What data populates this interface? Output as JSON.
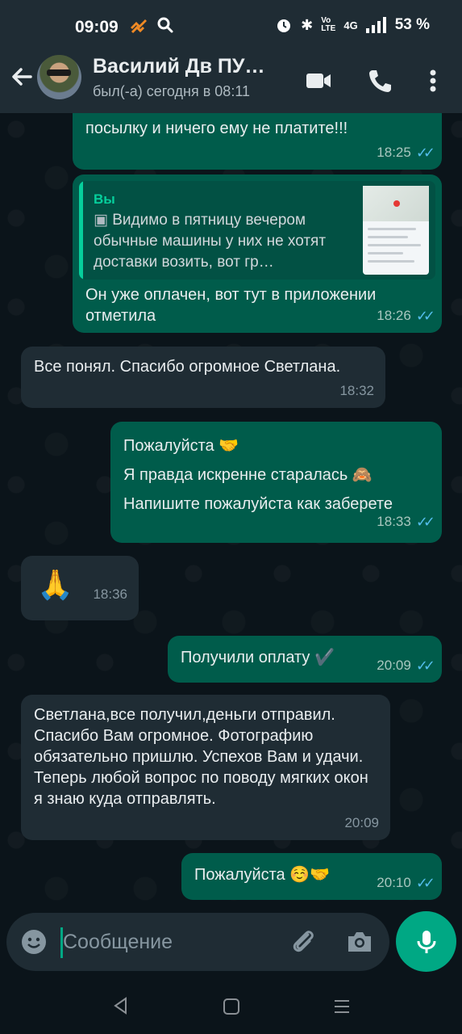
{
  "status_bar": {
    "time": "09:09",
    "battery_percent": "53 %",
    "network_label": "4G"
  },
  "header": {
    "contact_name": "Василий Дв ПУ…",
    "last_seen": "был(-а) сегодня в 08:11"
  },
  "messages": [
    {
      "direction": "out",
      "text": "посылку и ничего ему не платите!!!",
      "time": "18:25",
      "status": "read"
    },
    {
      "direction": "out",
      "reply_to": {
        "author": "Вы",
        "text": "Видимо в пятницу вечером обычные машины у них не хотят доставки возить, вот гр…",
        "has_image": true
      },
      "text": "Он уже оплачен, вот тут в приложении отметила",
      "time": "18:26",
      "status": "read"
    },
    {
      "direction": "in",
      "text": "Все понял. Спасибо огромное Светлана.",
      "time": "18:32"
    },
    {
      "direction": "out",
      "lines": [
        "Пожалуйста 🤝",
        "Я правда искренне старалась 🙈",
        "Напишите пожалуйста как заберете"
      ],
      "time": "18:33",
      "status": "read"
    },
    {
      "direction": "in",
      "text": "🙏",
      "time": "18:36"
    },
    {
      "direction": "out",
      "text": "Получили оплату ✔️",
      "time": "20:09",
      "status": "read"
    },
    {
      "direction": "in",
      "text": "Светлана,все получил,деньги отправил. Спасибо Вам огромное. Фотографию обязательно пришлю. Успехов Вам и удачи. Теперь любой вопрос по поводу мягких окон я знаю куда отправлять.",
      "time": "20:09"
    },
    {
      "direction": "out",
      "text": "Пожалуйста ☺️🤝",
      "time": "20:10",
      "status": "read"
    }
  ],
  "composer": {
    "placeholder": "Сообщение"
  },
  "colors": {
    "background": "#0b141a",
    "header": "#1f2c34",
    "outgoing_bubble": "#005c4b",
    "incoming_bubble": "#1f2c34",
    "accent": "#00a884",
    "read_ticks": "#53bdeb"
  },
  "icons": {
    "back": "arrow-left-icon",
    "video_call": "video-camera-icon",
    "voice_call": "phone-icon",
    "menu": "more-vertical-icon",
    "emoji": "emoji-icon",
    "attach": "paperclip-icon",
    "camera": "camera-icon",
    "mic": "mic-icon"
  }
}
